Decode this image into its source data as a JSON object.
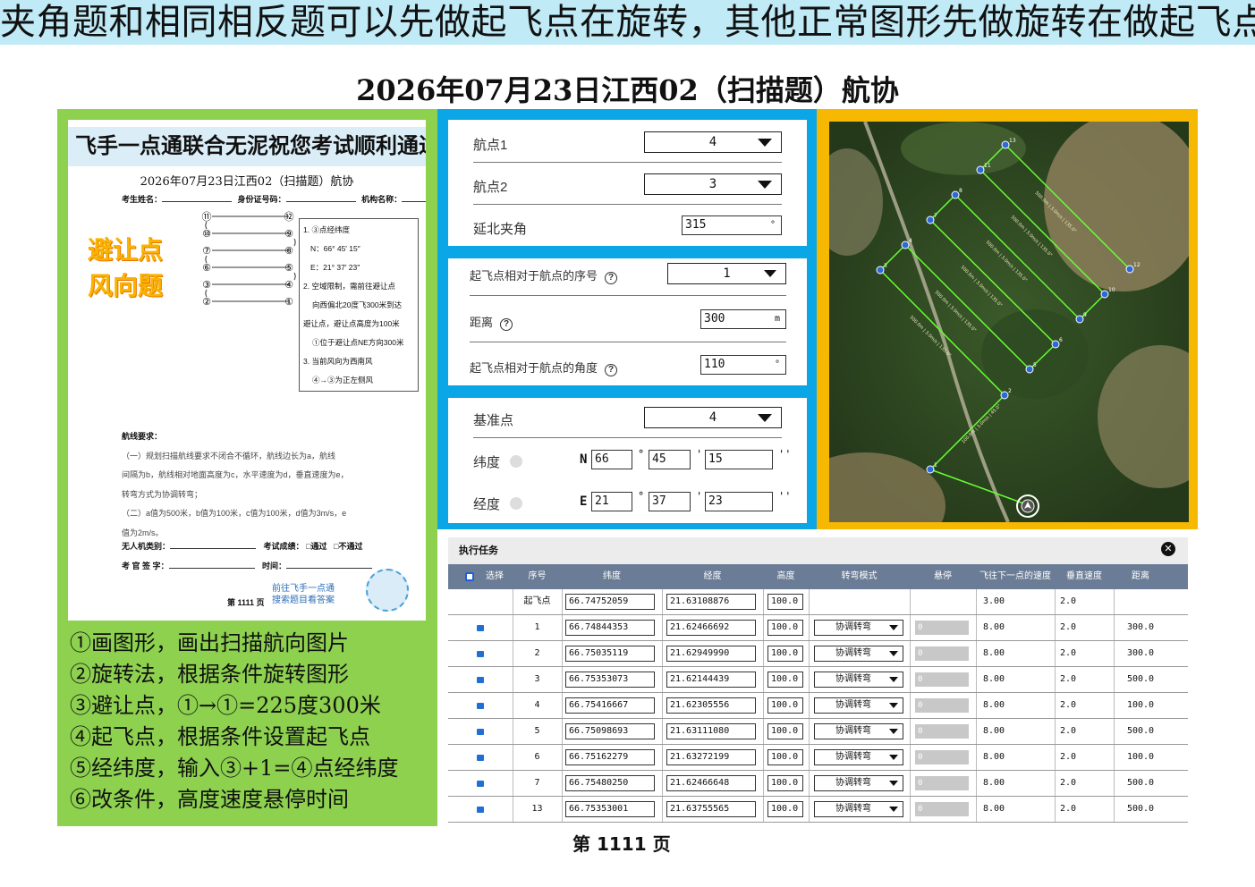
{
  "banner": "夹角题和相同相反题可以先做起飞点在旋转，其他正常图形先做旋转在做起飞点",
  "title": "2026年07月23日江西02（扫描题）航协",
  "paper": {
    "head": "飞手一点通联合无泥祝您考试顺利通过",
    "subtitle": "2026年07月23日江西02（扫描题）航协",
    "field_name": "考生姓名：",
    "field_id": "身份证号码：",
    "field_org": "机构名称：",
    "tag1": "避让点",
    "tag2": "风向题",
    "diagram_nodes": [
      "⑪",
      "⑫",
      "⑩",
      "⑨",
      "⑦",
      "⑧",
      "⑥",
      "⑤",
      "③",
      "④",
      "②",
      "①"
    ],
    "info_lines": [
      "1. ③点经纬度",
      "N：66° 45′ 15″",
      "E：21° 37′ 23″",
      "2. 空域限制，需前往避让点",
      "向西偏北20度飞300米到达",
      "避让点，避让点高度为100米",
      "①位于避让点NE方向300米",
      "3. 当前风向为西南风",
      "④→③为正左侧风"
    ],
    "req_title": "航线要求：",
    "req_lines": [
      "（一）规划扫描航线要求不闭合不循环，航线边长为a，航线",
      "间隔为b，航线相对地面高度为c，水平速度为d，垂直速度为e，",
      "转弯方式为协调转弯；",
      "（二）a值为500米，b值为100米，c值为100米，d值为3m/s，e",
      "值为2m/s。"
    ],
    "uav_type": "无人机类别：",
    "result": "考试成绩：",
    "pass": "□通过",
    "fail": "□不通过",
    "examiner": "考 官 签 字：",
    "time": "时间：",
    "qr_line1": "前往飞手一点通",
    "qr_line2": "搜索题目看答案",
    "page_small": "第 1111 页"
  },
  "steps": [
    "①画图形，画出扫描航向图片",
    "②旋转法，根据条件旋转图形",
    "③避让点，①→①=225度300米",
    "④起飞点，根据条件设置起飞点",
    "⑤经纬度，输入③+1=④点经纬度",
    "⑥改条件，高度速度悬停时间"
  ],
  "form1": {
    "wp1_label": "航点1",
    "wp1_value": "4",
    "wp2_label": "航点2",
    "wp2_value": "3",
    "angle_label": "延北夹角",
    "angle_value": "315",
    "angle_unit": "°"
  },
  "form2": {
    "seq_label": "起飞点相对于航点的序号",
    "seq_value": "1",
    "dist_label": "距离",
    "dist_value": "300",
    "dist_unit": "m",
    "ang_label": "起飞点相对于航点的角度",
    "ang_value": "110",
    "ang_unit": "°"
  },
  "form3": {
    "base_label": "基准点",
    "base_value": "4",
    "lat_label": "纬度",
    "lat_prefix": "N",
    "lat_deg": "66",
    "lat_min": "45",
    "lat_sec": "15",
    "lon_label": "经度",
    "lon_prefix": "E",
    "lon_deg": "21",
    "lon_min": "37",
    "lon_sec": "23",
    "deg_sym": "°",
    "min_sym": "'",
    "sec_sym": "''"
  },
  "map": {
    "labels": [
      "13",
      "12",
      "11",
      "8",
      "7",
      "4",
      "3",
      "10",
      "9",
      "6",
      "5",
      "2",
      "1"
    ],
    "seg_label_long": "500.0m | 3.0m/s | 135.0°",
    "seg_label_short": "100.0m | 3.0m/s | 45.0°"
  },
  "task": {
    "title": "执行任务",
    "headers": [
      "选择",
      "序号",
      "纬度",
      "经度",
      "高度",
      "转弯模式",
      "悬停",
      "飞往下一点的速度",
      "垂直速度",
      "距离"
    ],
    "rows": [
      {
        "seq": "起飞点",
        "lat": "66.74752059",
        "lon": "21.63108876",
        "alt": "100.0",
        "mode": "",
        "hover": "",
        "spd": "3.00",
        "vspd": "2.0",
        "dist": ""
      },
      {
        "seq": "1",
        "lat": "66.74844353",
        "lon": "21.62466692",
        "alt": "100.0",
        "mode": "协调转弯",
        "hover": "0",
        "spd": "8.00",
        "vspd": "2.0",
        "dist": "300.0"
      },
      {
        "seq": "2",
        "lat": "66.75035119",
        "lon": "21.62949990",
        "alt": "100.0",
        "mode": "协调转弯",
        "hover": "0",
        "spd": "8.00",
        "vspd": "2.0",
        "dist": "300.0"
      },
      {
        "seq": "3",
        "lat": "66.75353073",
        "lon": "21.62144439",
        "alt": "100.0",
        "mode": "协调转弯",
        "hover": "0",
        "spd": "8.00",
        "vspd": "2.0",
        "dist": "500.0"
      },
      {
        "seq": "4",
        "lat": "66.75416667",
        "lon": "21.62305556",
        "alt": "100.0",
        "mode": "协调转弯",
        "hover": "0",
        "spd": "8.00",
        "vspd": "2.0",
        "dist": "100.0"
      },
      {
        "seq": "5",
        "lat": "66.75098693",
        "lon": "21.63111080",
        "alt": "100.0",
        "mode": "协调转弯",
        "hover": "0",
        "spd": "8.00",
        "vspd": "2.0",
        "dist": "500.0"
      },
      {
        "seq": "6",
        "lat": "66.75162279",
        "lon": "21.63272199",
        "alt": "100.0",
        "mode": "协调转弯",
        "hover": "0",
        "spd": "8.00",
        "vspd": "2.0",
        "dist": "100.0"
      },
      {
        "seq": "7",
        "lat": "66.75480250",
        "lon": "21.62466648",
        "alt": "100.0",
        "mode": "协调转弯",
        "hover": "0",
        "spd": "8.00",
        "vspd": "2.0",
        "dist": "500.0"
      },
      {
        "seq": "13",
        "lat": "66.75353001",
        "lon": "21.63755565",
        "alt": "100.0",
        "mode": "协调转弯",
        "hover": "0",
        "spd": "8.00",
        "vspd": "2.0",
        "dist": "500.0"
      }
    ]
  },
  "bottom_page": "第 1111 页"
}
